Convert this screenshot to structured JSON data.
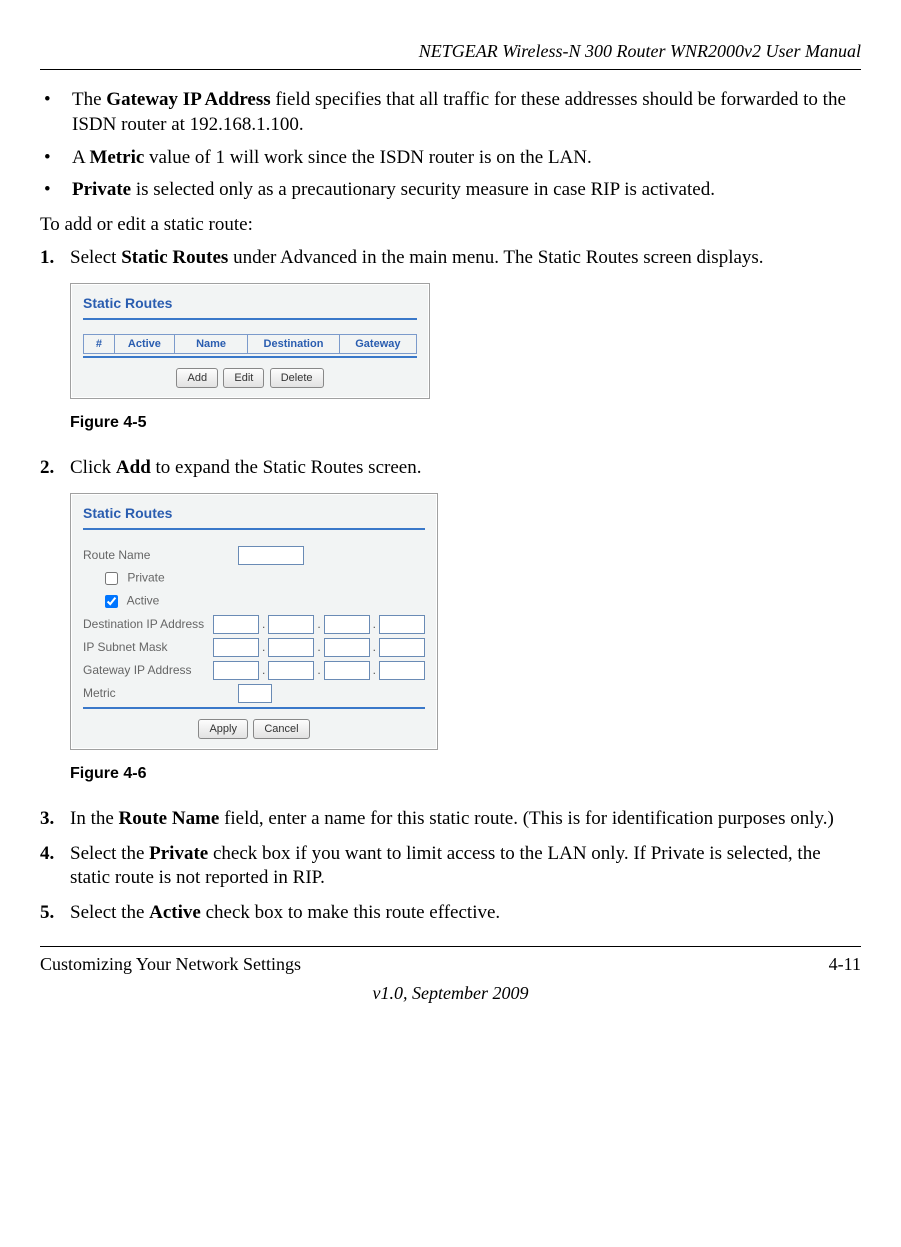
{
  "header": "NETGEAR Wireless-N 300 Router WNR2000v2 User Manual",
  "bullets": {
    "b1_pre": "The ",
    "b1_bold": "Gateway IP Address",
    "b1_post": " field specifies that all traffic for these addresses should be forwarded to the ISDN router at 192.168.1.100.",
    "b2_pre": "A ",
    "b2_bold": "Metric",
    "b2_post": " value of 1 will work since the ISDN router is on the LAN.",
    "b3_bold": "Private",
    "b3_post": " is selected only as a precautionary security measure in case RIP is activated."
  },
  "lead": "To add or edit a static route:",
  "steps": {
    "s1_num": "1.",
    "s1_pre": "Select ",
    "s1_bold": "Static Routes",
    "s1_post": " under Advanced in the main menu. The Static Routes screen displays.",
    "s2_num": "2.",
    "s2_pre": "Click ",
    "s2_bold": "Add",
    "s2_post": " to expand the Static Routes screen.",
    "s3_num": "3.",
    "s3_pre": "In the ",
    "s3_bold": "Route Name",
    "s3_post": " field, enter a name for this static route. (This is for identification purposes only.)",
    "s4_num": "4.",
    "s4_pre": "Select the ",
    "s4_bold": "Private",
    "s4_post": " check box if you want to limit access to the LAN only. If Private is selected, the static route is not reported in RIP.",
    "s5_num": "5.",
    "s5_pre": "Select the ",
    "s5_bold": "Active",
    "s5_post": " check box to make this route effective."
  },
  "fig45": {
    "title": "Static Routes",
    "cols": {
      "c1": "#",
      "c2": "Active",
      "c3": "Name",
      "c4": "Destination",
      "c5": "Gateway"
    },
    "buttons": {
      "add": "Add",
      "edit": "Edit",
      "del": "Delete"
    },
    "caption": "Figure 4-5"
  },
  "fig46": {
    "title": "Static Routes",
    "labels": {
      "routeName": "Route Name",
      "private": "Private",
      "active": "Active",
      "dest": "Destination IP Address",
      "mask": "IP Subnet Mask",
      "gw": "Gateway IP Address",
      "metric": "Metric"
    },
    "buttons": {
      "apply": "Apply",
      "cancel": "Cancel"
    },
    "caption": "Figure 4-6"
  },
  "footer": {
    "left": "Customizing Your Network Settings",
    "right": "4-11",
    "center": "v1.0, September 2009"
  }
}
